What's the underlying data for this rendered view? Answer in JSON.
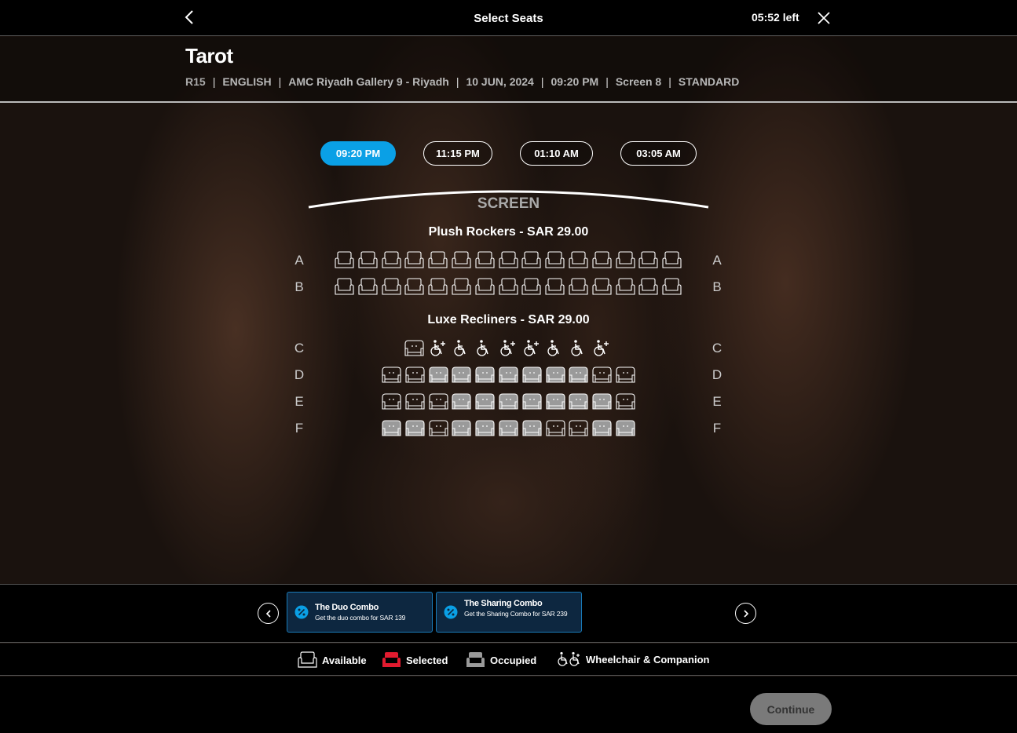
{
  "topbar": {
    "title": "Select Seats",
    "timer": "05:52 left"
  },
  "movie": {
    "title": "Tarot",
    "rating": "R15",
    "meta": [
      "ENGLISH",
      "AMC Riyadh Gallery 9 - Riyadh",
      "10 JUN, 2024",
      "09:20 PM",
      "Screen 8",
      "STANDARD"
    ]
  },
  "showtimes": [
    {
      "label": "09:20 PM",
      "active": true
    },
    {
      "label": "11:15 PM",
      "active": false
    },
    {
      "label": "01:10 AM",
      "active": false
    },
    {
      "label": "03:05 AM",
      "active": false
    }
  ],
  "screen_label": "SCREEN",
  "sections": [
    {
      "title": "Plush Rockers -  SAR  29.00",
      "rows": [
        "A",
        "B"
      ]
    },
    {
      "title": "Luxe Recliners -  SAR  29.00",
      "rows": [
        "C",
        "D",
        "E",
        "F"
      ]
    }
  ],
  "seat_rows": {
    "A": [
      "available",
      "available",
      "available",
      "available",
      "available",
      "available",
      "available",
      "available",
      "available",
      "available",
      "available",
      "available",
      "available",
      "available",
      "available"
    ],
    "B": [
      "available",
      "available",
      "available",
      "available",
      "available",
      "available",
      "available",
      "available",
      "available",
      "available",
      "available",
      "available",
      "available",
      "available",
      "available"
    ],
    "C": [
      "available",
      "wheelchair-companion",
      "wheelchair",
      "wheelchair",
      "wheelchair-companion",
      "wheelchair-companion",
      "wheelchair",
      "wheelchair",
      "wheelchair-companion"
    ],
    "D": [
      "available",
      "available",
      "occupied",
      "occupied",
      "occupied",
      "occupied",
      "occupied",
      "occupied",
      "occupied",
      "available",
      "available"
    ],
    "E": [
      "available",
      "available",
      "available",
      "occupied",
      "occupied",
      "occupied",
      "occupied",
      "occupied",
      "occupied",
      "occupied",
      "available"
    ],
    "F": [
      "occupied",
      "occupied",
      "available",
      "occupied",
      "occupied",
      "occupied",
      "occupied",
      "available",
      "available",
      "occupied",
      "occupied"
    ]
  },
  "combos": [
    {
      "name": "The Duo Combo",
      "desc": "Get the duo combo for SAR 139"
    },
    {
      "name": "The Sharing Combo",
      "desc": "Get the Sharing Combo for SAR 239"
    }
  ],
  "legend": {
    "available": "Available",
    "selected": "Selected",
    "occupied": "Occupied",
    "wheelchair": "Wheelchair & Companion"
  },
  "colors": {
    "accent": "#0aa0e6",
    "selected": "#e21b2f",
    "occupied": "#9a9a9a",
    "combo_border": "#1a7bb8"
  },
  "continue_label": "Continue"
}
